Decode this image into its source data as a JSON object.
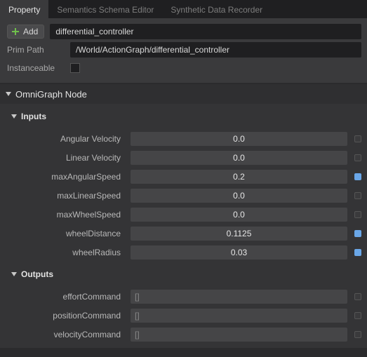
{
  "tabs": {
    "property": "Property",
    "semantics": "Semantics Schema Editor",
    "recorder": "Synthetic Data Recorder"
  },
  "top": {
    "add_label": "Add",
    "name_value": "differential_controller",
    "primpath_label": "Prim Path",
    "primpath_value": "/World/ActionGraph/differential_controller",
    "instanceable_label": "Instanceable"
  },
  "section": {
    "omnigraph": "OmniGraph Node",
    "inputs": "Inputs",
    "outputs": "Outputs"
  },
  "inputs": {
    "angularVelocity": {
      "label": "Angular Velocity",
      "value": "0.0",
      "marked": false
    },
    "linearVelocity": {
      "label": "Linear Velocity",
      "value": "0.0",
      "marked": false
    },
    "maxAngularSpeed": {
      "label": "maxAngularSpeed",
      "value": "0.2",
      "marked": true
    },
    "maxLinearSpeed": {
      "label": "maxLinearSpeed",
      "value": "0.0",
      "marked": false
    },
    "maxWheelSpeed": {
      "label": "maxWheelSpeed",
      "value": "0.0",
      "marked": false
    },
    "wheelDistance": {
      "label": "wheelDistance",
      "value": "0.1125",
      "marked": true
    },
    "wheelRadius": {
      "label": "wheelRadius",
      "value": "0.03",
      "marked": true
    }
  },
  "outputs": {
    "effortCommand": {
      "label": "effortCommand",
      "value": "[]"
    },
    "positionCommand": {
      "label": "positionCommand",
      "value": "[]"
    },
    "velocityCommand": {
      "label": "velocityCommand",
      "value": "[]"
    }
  }
}
